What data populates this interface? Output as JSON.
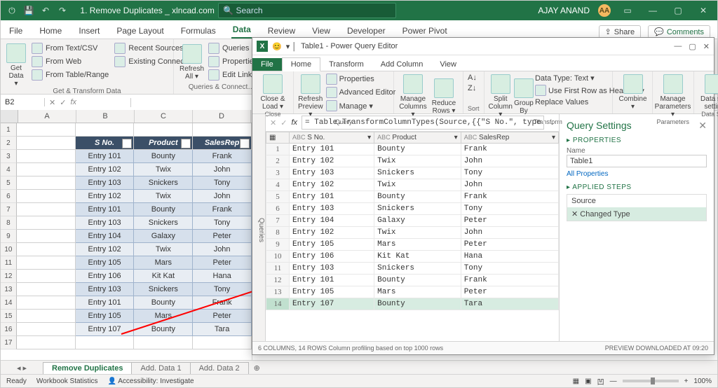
{
  "title": "1. Remove Duplicates _ xlncad.com",
  "search_placeholder": "Search",
  "user_name": "AJAY ANAND",
  "user_initials": "AA",
  "excel_tabs": [
    "File",
    "Home",
    "Insert",
    "Page Layout",
    "Formulas",
    "Data",
    "Review",
    "View",
    "Developer",
    "Power Pivot"
  ],
  "active_excel_tab": "Data",
  "share_label": "Share",
  "comments_label": "Comments",
  "ribbon_get_data": "Get\nData ▾",
  "ribbon_src": [
    "From Text/CSV",
    "From Web",
    "From Table/Range",
    "Recent Sources",
    "Existing Connections"
  ],
  "group1_label": "Get & Transform Data",
  "refresh_all": "Refresh\nAll ▾",
  "ribbon_q": [
    "Queries & Co…",
    "Properties",
    "Edit Links"
  ],
  "group2_label": "Queries & Connect…",
  "name_box": "B2",
  "fx_label": "fx",
  "col_letters": [
    "A",
    "B",
    "C",
    "D"
  ],
  "table_headers": [
    "S No.",
    "Product",
    "SalesRep"
  ],
  "table_rows": [
    [
      "Entry 101",
      "Bounty",
      "Frank"
    ],
    [
      "Entry 102",
      "Twix",
      "John"
    ],
    [
      "Entry 103",
      "Snickers",
      "Tony"
    ],
    [
      "Entry 102",
      "Twix",
      "John"
    ],
    [
      "Entry 101",
      "Bounty",
      "Frank"
    ],
    [
      "Entry 103",
      "Snickers",
      "Tony"
    ],
    [
      "Entry 104",
      "Galaxy",
      "Peter"
    ],
    [
      "Entry 102",
      "Twix",
      "John"
    ],
    [
      "Entry 105",
      "Mars",
      "Peter"
    ],
    [
      "Entry 106",
      "Kit Kat",
      "Hana"
    ],
    [
      "Entry 103",
      "Snickers",
      "Tony"
    ],
    [
      "Entry 101",
      "Bounty",
      "Frank"
    ],
    [
      "Entry 105",
      "Mars",
      "Peter"
    ],
    [
      "Entry 107",
      "Bounty",
      "Tara"
    ]
  ],
  "sheet_tabs": [
    "Remove Duplicates",
    "Add. Data 1",
    "Add. Data 2"
  ],
  "status_ready": "Ready",
  "status_wbstats": "Workbook Statistics",
  "status_access": "Accessibility: Investigate",
  "zoom_pct": "100%",
  "pq_title": "Table1 - Power Query Editor",
  "pq_tabs": [
    "File",
    "Home",
    "Transform",
    "Add Column",
    "View"
  ],
  "pq_close_load": "Close &\nLoad ▾",
  "pq_close_grp": "Close",
  "pq_refresh": "Refresh\nPreview ▾",
  "pq_query_items": [
    "Properties",
    "Advanced Editor",
    "Manage ▾"
  ],
  "pq_query_grp": "Query",
  "pq_cols_items": [
    "Manage\nColumns ▾",
    "Reduce\nRows ▾"
  ],
  "pq_sort_grp": "Sort",
  "pq_split_grp": [
    "Split\nColumn ▾",
    "Group\nBy"
  ],
  "pq_transform_items": [
    "Data Type: Text ▾",
    "Use First Row as Headers ▾",
    "Replace Values"
  ],
  "pq_transform_grp": "Transform",
  "pq_combine": "Combine\n▾",
  "pq_params": "Manage\nParameters ▾",
  "pq_params_grp": "Parameters",
  "pq_dsrc": "Data sou\nsetting",
  "pq_dsrc_grp": "Data Sou",
  "pq_sidebar_tab": "Queries",
  "pq_fx": "fx",
  "pq_formula": "= Table.TransformColumnTypes(Source,{{\"S No.\", type",
  "pq_headers": [
    "",
    "S No.",
    "Product",
    "SalesRep"
  ],
  "pq_type_tag": "ABC",
  "pq_rows": [
    [
      "1",
      "Entry 101",
      "Bounty",
      "Frank"
    ],
    [
      "2",
      "Entry 102",
      "Twix",
      "John"
    ],
    [
      "3",
      "Entry 103",
      "Snickers",
      "Tony"
    ],
    [
      "4",
      "Entry 102",
      "Twix",
      "John"
    ],
    [
      "5",
      "Entry 101",
      "Bounty",
      "Frank"
    ],
    [
      "6",
      "Entry 103",
      "Snickers",
      "Tony"
    ],
    [
      "7",
      "Entry 104",
      "Galaxy",
      "Peter"
    ],
    [
      "8",
      "Entry 102",
      "Twix",
      "John"
    ],
    [
      "9",
      "Entry 105",
      "Mars",
      "Peter"
    ],
    [
      "10",
      "Entry 106",
      "Kit Kat",
      "Hana"
    ],
    [
      "11",
      "Entry 103",
      "Snickers",
      "Tony"
    ],
    [
      "12",
      "Entry 101",
      "Bounty",
      "Frank"
    ],
    [
      "13",
      "Entry 105",
      "Mars",
      "Peter"
    ],
    [
      "14",
      "Entry 107",
      "Bounty",
      "Tara"
    ]
  ],
  "qs_title": "Query Settings",
  "qs_props": "PROPERTIES",
  "qs_name_lbl": "Name",
  "qs_name_val": "Table1",
  "qs_allprops": "All Properties",
  "qs_steps": "APPLIED STEPS",
  "qs_step1": "Source",
  "qs_step2": "Changed Type",
  "pq_footer_left": "6 COLUMNS, 14 ROWS    Column profiling based on top 1000 rows",
  "pq_footer_right": "PREVIEW DOWNLOADED AT 09:20"
}
